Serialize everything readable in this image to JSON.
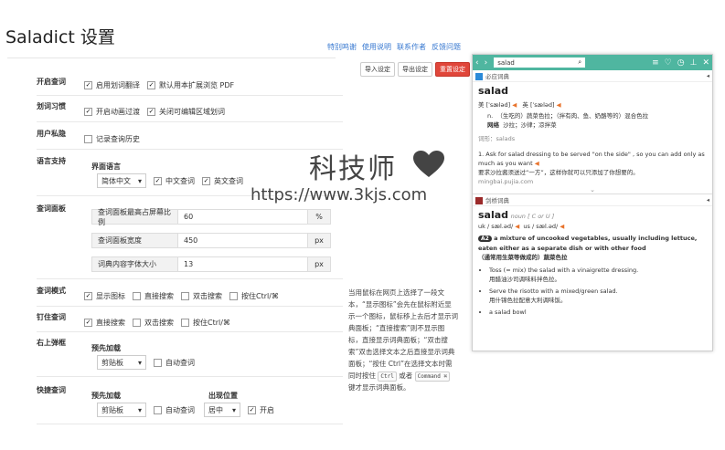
{
  "header": {
    "title": "Saladict 设置",
    "links": [
      "特别鸣谢",
      "使用说明",
      "联系作者",
      "反馈问题"
    ],
    "buttons": {
      "import": "导入设定",
      "export": "导出设定",
      "reset": "重置设定"
    }
  },
  "sections": {
    "enable": {
      "label": "开启查词",
      "options": [
        {
          "label": "启用划词翻译",
          "checked": true
        },
        {
          "label": "默认用本扩展浏览 PDF",
          "checked": true
        }
      ]
    },
    "habits": {
      "label": "划词习惯",
      "options": [
        {
          "label": "开启动画过渡",
          "checked": true
        },
        {
          "label": "关闭可编辑区域划词",
          "checked": true
        }
      ]
    },
    "privacy": {
      "label": "用户私隐",
      "options": [
        {
          "label": "记录查询历史",
          "checked": false
        }
      ]
    },
    "language": {
      "label": "语言支持",
      "ui_label": "界面语言",
      "ui_value": "简体中文",
      "options": [
        {
          "label": "中文查词",
          "checked": true
        },
        {
          "label": "英文查词",
          "checked": true
        }
      ]
    },
    "panel": {
      "label": "查词面板",
      "fields": [
        {
          "label": "查词面板最高占屏幕比例",
          "value": "60",
          "unit": "%"
        },
        {
          "label": "查词面板宽度",
          "value": "450",
          "unit": "px"
        },
        {
          "label": "词典内容字体大小",
          "value": "13",
          "unit": "px"
        }
      ]
    },
    "mode": {
      "label": "查词模式",
      "options": [
        {
          "label": "显示图标",
          "checked": true
        },
        {
          "label": "直接搜索",
          "checked": false
        },
        {
          "label": "双击搜索",
          "checked": false
        },
        {
          "label": "按住Ctrl/⌘",
          "checked": false
        }
      ]
    },
    "pin": {
      "label": "钉住查词",
      "options": [
        {
          "label": "直接搜索",
          "checked": true
        },
        {
          "label": "双击搜索",
          "checked": false
        },
        {
          "label": "按住Ctrl/⌘",
          "checked": false
        }
      ]
    },
    "corner": {
      "label": "右上弹框",
      "preload_label": "预先加载",
      "preload_value": "剪贴板",
      "options": [
        {
          "label": "自动查词",
          "checked": false
        }
      ]
    },
    "quick": {
      "label": "快捷查词",
      "preload_label": "预先加载",
      "preload_value": "剪贴板",
      "auto_label": "自动查词",
      "auto_checked": false,
      "position_label": "出现位置",
      "position_value": "居中",
      "open_label": "开启",
      "open_checked": true
    }
  },
  "help_text": {
    "p1": "当用鼠标在网页上选择了一段文本，“显示图标”会先在鼠标附近显示一个图标，鼠标移上去后才显示词典面板；“直接搜索”则不显示图标，直接显示词典面板；“双击搜索”双击选择文本之后直接显示词典面板；“按住 Ctrl”在选择文本时需同时按住",
    "kbd1": "Ctrl",
    "or": "或者",
    "kbd2": "Command ⌘",
    "p2": "键才显示词典面板。"
  },
  "popup": {
    "search_value": "salad",
    "bing": {
      "name": "必应词典",
      "word": "salad",
      "phonetic_us": "美 [ˈsæləd]",
      "phonetic_uk": "英 [ˈsæləd]",
      "pos": "n.",
      "def": "（生吃的）蔬菜色拉；（拌有肉、鱼、奶酪等的）混合色拉",
      "web_label": "网络",
      "web_def": "沙拉；沙律；凉拌菜",
      "forms": "词形：salads",
      "ex_en": "1. Ask for salad dressing to be served \"on the side\" , so you can add only as much as you want",
      "ex_zh": "要求沙拉酱须送过“一方”，这样你就可以只添加了你想要的。",
      "ex_src": "mingbai.pujia.com"
    },
    "cambridge": {
      "name": "剑桥词典",
      "word": "salad",
      "pos": "noun [ C or U ]",
      "uk": "uk / sæl.əd/",
      "us": "us / sæl.əd/",
      "level": "A2",
      "def": "a mixture of uncooked vegetables, usually including lettuce, eaten either as a separate dish or with other food",
      "def_zh": "（通常用生菜等做成的）蔬菜色拉",
      "ex1": "Toss (= mix) the salad with a vinaigrette dressing.",
      "ex1_zh": "用醋油沙司调味料拌色拉。",
      "ex2": "Serve the risotto with a mixed/green salad.",
      "ex2_zh": "用什锦色拉配意大利调味饭。",
      "ex3": "a salad bowl"
    }
  },
  "watermark": {
    "cn": "科技师",
    "url": "https://www.3kjs.com"
  },
  "colors": {
    "accent": "#4fb6a0",
    "link": "#3a7ad1",
    "danger": "#e0463a",
    "orange": "#e8732c"
  }
}
